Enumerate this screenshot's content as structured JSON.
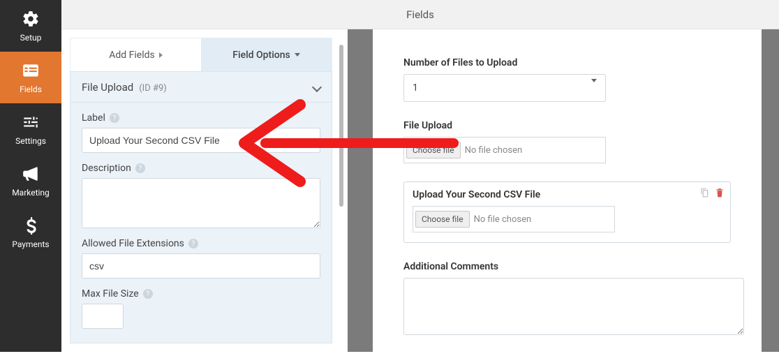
{
  "header": {
    "title": "Fields"
  },
  "sidebar": {
    "items": [
      {
        "label": "Setup"
      },
      {
        "label": "Fields"
      },
      {
        "label": "Settings"
      },
      {
        "label": "Marketing"
      },
      {
        "label": "Payments"
      }
    ]
  },
  "tabs": {
    "add": "Add Fields",
    "options": "Field Options"
  },
  "section": {
    "title": "File Upload",
    "id": "(ID #9)"
  },
  "form": {
    "label_title": "Label",
    "label_value": "Upload Your Second CSV File",
    "description_title": "Description",
    "description_value": "",
    "allowed_title": "Allowed File Extensions",
    "allowed_value": "csv",
    "maxsize_title": "Max File Size",
    "maxsize_value": ""
  },
  "preview": {
    "num_files_label": "Number of Files to Upload",
    "num_files_value": "1",
    "upload1_label": "File Upload",
    "upload2_label": "Upload Your Second CSV File",
    "choose_file": "Choose file",
    "no_file": "No file chosen",
    "comments_label": "Additional Comments"
  }
}
